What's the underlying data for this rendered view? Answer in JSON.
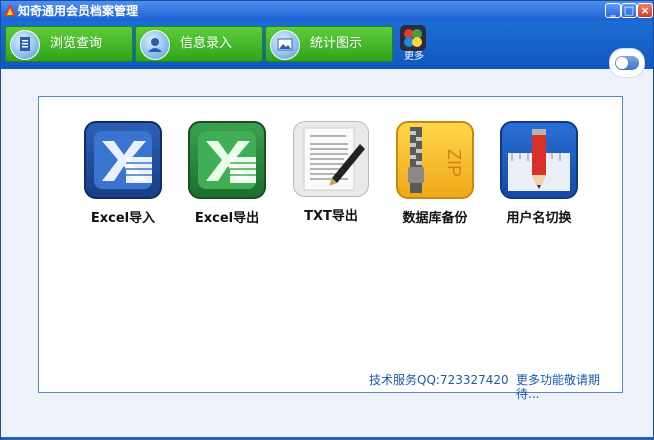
{
  "window": {
    "title": "知奇通用会员档案管理"
  },
  "toolbar": {
    "tabs": [
      {
        "label": "浏览查询",
        "icon": "document-icon"
      },
      {
        "label": "信息录入",
        "icon": "user-icon"
      },
      {
        "label": "统计图示",
        "icon": "image-icon"
      }
    ],
    "more_label": "更多"
  },
  "functions": [
    {
      "label": "Excel导入",
      "icon": "excel-import-icon"
    },
    {
      "label": "Excel导出",
      "icon": "excel-export-icon"
    },
    {
      "label": "TXT导出",
      "icon": "txt-document-pen-icon"
    },
    {
      "label": "数据库备份",
      "icon": "zip-archive-icon"
    },
    {
      "label": "用户名切换",
      "icon": "pencil-ruler-icon"
    }
  ],
  "footer": {
    "support": "技术服务QQ:723327420",
    "more": "更多功能敬请期待..."
  }
}
